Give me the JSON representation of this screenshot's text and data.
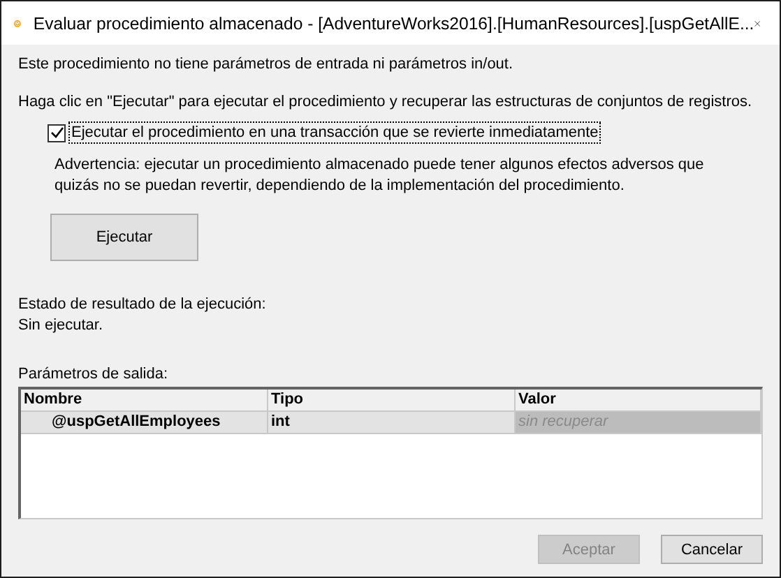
{
  "window": {
    "title": "Evaluar procedimiento almacenado - [AdventureWorks2016].[HumanResources].[uspGetAllE..."
  },
  "info": "Este procedimiento no tiene parámetros de entrada ni parámetros in/out.",
  "hint": "Haga clic en \"Ejecutar\" para ejecutar el procedimiento y recuperar las estructuras de conjuntos de registros.",
  "rollback": {
    "label": "Ejecutar el procedimiento en una transacción que se revierte inmediatamente",
    "checked": true
  },
  "warning": "Advertencia: ejecutar un procedimiento almacenado puede tener algunos efectos adversos que quizás no se puedan revertir, dependiendo de la implementación del procedimiento.",
  "execute_button": "Ejecutar",
  "status_label": "Estado de resultado de la ejecución:",
  "status_value": "Sin ejecutar.",
  "output_label": "Parámetros de salida:",
  "table": {
    "columns": [
      "Nombre",
      "Tipo",
      "Valor"
    ],
    "rows": [
      {
        "name": "@uspGetAllEmployees",
        "type": "int",
        "value": "sin recuperar",
        "selected": true
      }
    ]
  },
  "buttons": [
    {
      "label": "Aceptar",
      "disabled": true
    },
    {
      "label": "Cancelar",
      "disabled": false
    }
  ]
}
